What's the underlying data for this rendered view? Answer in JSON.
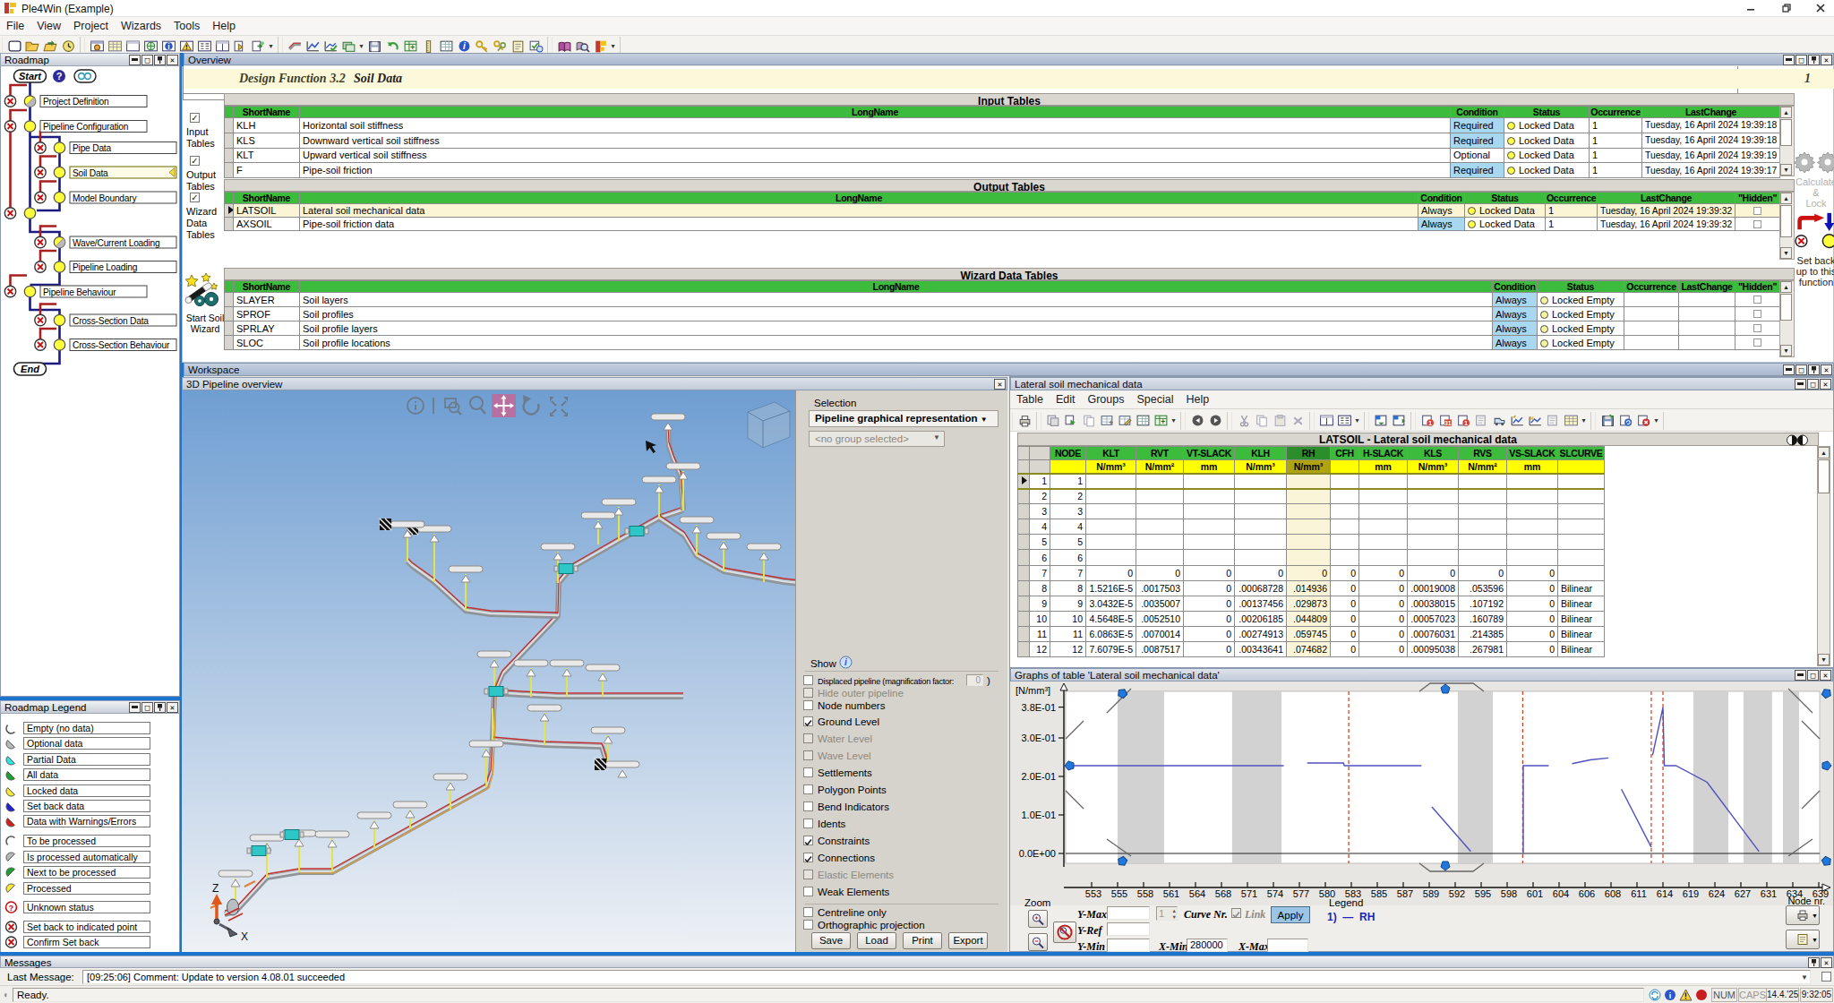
{
  "app": {
    "title": "Ple4Win (Example)"
  },
  "menu": [
    "File",
    "View",
    "Project",
    "Wizards",
    "Tools",
    "Help"
  ],
  "toolbar": {
    "groups": [
      [
        "new-doc-icon",
        "open-folder-icon",
        "import-folder-icon",
        "history-clock-icon"
      ],
      [
        "window-gear-icon",
        "window-table-icon",
        "window-blank-icon",
        "window-globe-icon",
        "window-info-icon",
        "window-warning-icon",
        "window-tree-icon",
        "window-split-icon",
        "copy-doc-icon",
        "export-doc-icon",
        "dropdown-icon"
      ],
      [
        "pipeline-icon",
        "chart-design-icon",
        "chart-check-icon",
        "layers-icon",
        "dropdown-icon",
        "floppy-icon",
        "undo-icon",
        "calc-table-icon",
        "ruler-icon",
        "table-small-icon",
        "info-icon",
        "key-icon",
        "key-pair-icon",
        "notes-icon",
        "link-check-icon"
      ],
      [
        "book-icon",
        "book-search-icon",
        "bookmark-icon",
        "dropdown-icon"
      ]
    ]
  },
  "roadmap": {
    "title": "Roadmap",
    "start_label": "Start",
    "end_label": "End",
    "nodes": [
      {
        "label": "Project Definition",
        "level": 0,
        "state": "locked-auto"
      },
      {
        "label": "Pipeline Configuration",
        "level": 0,
        "state": "locked"
      },
      {
        "label": "Pipe Data",
        "level": 1,
        "state": "locked"
      },
      {
        "label": "Soil Data",
        "level": 1,
        "state": "locked",
        "selected": true
      },
      {
        "label": "Model Boundary",
        "level": 1,
        "state": "locked"
      },
      {
        "label": "",
        "level": 0,
        "state": "locked",
        "junction": true
      },
      {
        "label": "Wave/Current Loading",
        "level": 1,
        "state": "locked-auto"
      },
      {
        "label": "Pipeline Loading",
        "level": 1,
        "state": "locked"
      },
      {
        "label": "Pipeline Behaviour",
        "level": 0,
        "state": "locked"
      },
      {
        "label": "Cross-Section Data",
        "level": 1,
        "state": "locked"
      },
      {
        "label": "Cross-Section Behaviour",
        "level": 1,
        "state": "locked"
      }
    ]
  },
  "legend": {
    "title": "Roadmap Legend",
    "items": [
      {
        "label": "Empty (no data)",
        "icon": "half-open"
      },
      {
        "label": "Optional data",
        "icon": "half-gray"
      },
      {
        "label": "Partial Data",
        "icon": "half-cyan"
      },
      {
        "label": "All data",
        "icon": "half-green"
      },
      {
        "label": "Locked data",
        "icon": "half-yellow"
      },
      {
        "label": "Set back data",
        "icon": "half-blue"
      },
      {
        "label": "Data with Warnings/Errors",
        "icon": "half-red"
      },
      {
        "label": "To be processed",
        "icon": "arc-open"
      },
      {
        "label": "Is processed automatically",
        "icon": "arc-gray"
      },
      {
        "label": "Next to be processed",
        "icon": "arc-green"
      },
      {
        "label": "Processed",
        "icon": "arc-yellow"
      },
      {
        "label": "Unknown status",
        "icon": "circle-question"
      },
      {
        "label": "Set back to indicated point",
        "icon": "circle-x"
      },
      {
        "label": "Confirm Set back",
        "icon": "circle-x"
      }
    ]
  },
  "overview": {
    "title": "Overview",
    "design_function": "Design Function 3.2",
    "design_name": "Soil Data",
    "page_number": "1",
    "gutter": {
      "input": [
        "Input",
        "Tables"
      ],
      "output": [
        "Output",
        "Tables"
      ],
      "wizard": [
        "Wizard",
        "Data",
        "Tables"
      ],
      "start_wizard": [
        "Start Soil",
        "Wizard"
      ]
    },
    "calc_lock": [
      "Calculate",
      "&",
      "Lock"
    ],
    "set_back": [
      "Set back",
      "up to this",
      "function"
    ],
    "input_tables": {
      "title": "Input Tables",
      "columns": [
        "ShortName",
        "LongName",
        "Condition",
        "Status",
        "Occurrence",
        "LastChange"
      ],
      "rows": [
        {
          "short": "KLH",
          "long": "Horizontal soil stiffness",
          "condition": "Required",
          "status": "Locked Data",
          "occ": "1",
          "change": "Tuesday, 16 April 2024 19:39:18"
        },
        {
          "short": "KLS",
          "long": "Downward vertical soil stiffness",
          "condition": "Required",
          "status": "Locked Data",
          "occ": "1",
          "change": "Tuesday, 16 April 2024 19:39:18"
        },
        {
          "short": "KLT",
          "long": "Upward vertical soil stiffness",
          "condition": "Optional",
          "status": "Locked Data",
          "occ": "1",
          "change": "Tuesday, 16 April 2024 19:39:19"
        },
        {
          "short": "F",
          "long": "Pipe-soil friction",
          "condition": "Required",
          "status": "Locked Data",
          "occ": "1",
          "change": "Tuesday, 16 April 2024 19:39:17"
        }
      ]
    },
    "output_tables": {
      "title": "Output Tables",
      "columns": [
        "ShortName",
        "LongName",
        "Condition",
        "Status",
        "Occurrence",
        "LastChange",
        "\"Hidden\""
      ],
      "rows": [
        {
          "short": "LATSOIL",
          "long": "Lateral soil mechanical data",
          "condition": "Always",
          "status": "Locked Data",
          "occ": "1",
          "change": "Tuesday, 16 April 2024 19:39:32",
          "selected": true
        },
        {
          "short": "AXSOIL",
          "long": "Pipe-soil friction data",
          "condition": "Always",
          "status": "Locked Data",
          "occ": "1",
          "change": "Tuesday, 16 April 2024 19:39:32"
        }
      ]
    },
    "wizard_tables": {
      "title": "Wizard Data Tables",
      "columns": [
        "ShortName",
        "LongName",
        "Condition",
        "Status",
        "Occurrence",
        "LastChange",
        "\"Hidden\""
      ],
      "rows": [
        {
          "short": "SLAYER",
          "long": "Soil layers",
          "condition": "Always",
          "status": "Locked Empty"
        },
        {
          "short": "SPROF",
          "long": "Soil profiles",
          "condition": "Always",
          "status": "Locked Empty"
        },
        {
          "short": "SPRLAY",
          "long": "Soil profile layers",
          "condition": "Always",
          "status": "Locked Empty"
        },
        {
          "short": "SLOC",
          "long": "Soil profile locations",
          "condition": "Always",
          "status": "Locked Empty"
        }
      ]
    }
  },
  "workspace": {
    "title": "Workspace"
  },
  "view3d": {
    "title": "3D Pipeline overview",
    "selection_label": "Selection",
    "dropdown1": "Pipeline graphical representation",
    "dropdown2": "<no group selected>",
    "show_label": "Show",
    "magnification_value": "0",
    "show_items": [
      {
        "label": "Displaced pipeline (magnification factor:",
        "suffix": ")",
        "state": "off",
        "field": "0"
      },
      {
        "label": "Hide outer pipeline",
        "state": "disabled"
      },
      {
        "label": "Node numbers",
        "state": "off"
      },
      {
        "label": "Ground Level",
        "state": "on"
      },
      {
        "label": "Water Level",
        "state": "disabled"
      },
      {
        "label": "Wave Level",
        "state": "disabled"
      },
      {
        "label": "Settlements",
        "state": "off"
      },
      {
        "label": "Polygon Points",
        "state": "off"
      },
      {
        "label": "Bend Indicators",
        "state": "off"
      },
      {
        "label": "Idents",
        "state": "off"
      },
      {
        "label": "Constraints",
        "state": "on"
      },
      {
        "label": "Connections",
        "state": "on"
      },
      {
        "label": "Elastic Elements",
        "state": "disabled"
      },
      {
        "label": "Weak Elements",
        "state": "off"
      }
    ],
    "show_items2": [
      {
        "label": "Centreline only",
        "state": "off"
      },
      {
        "label": "Orthographic projection",
        "state": "off"
      }
    ],
    "buttons": [
      "Save",
      "Load",
      "Print",
      "Export"
    ],
    "axes": {
      "z": "Z",
      "x": "X"
    }
  },
  "latsoil": {
    "title": "Lateral soil mechanical data",
    "menu": [
      "Table",
      "Edit",
      "Groups",
      "Special",
      "Help"
    ],
    "table_title": "LATSOIL - Lateral soil mechanical data",
    "columns": [
      "NODE",
      "KLT",
      "RVT",
      "VT-SLACK",
      "KLH",
      "RH",
      "CFH",
      "H-SLACK",
      "KLS",
      "RVS",
      "VS-SLACK",
      "SLCURVE"
    ],
    "units": [
      "",
      "N/mm³",
      "N/mm²",
      "mm",
      "N/mm³",
      "N/mm³",
      "",
      "mm",
      "N/mm³",
      "N/mm²",
      "mm",
      ""
    ],
    "selected_column": "RH",
    "rows": [
      [
        "1",
        "1",
        "",
        "",
        "",
        "",
        "",
        "",
        "",
        "",
        "",
        "",
        ""
      ],
      [
        "2",
        "2",
        "",
        "",
        "",
        "",
        "",
        "",
        "",
        "",
        "",
        "",
        ""
      ],
      [
        "3",
        "3",
        "",
        "",
        "",
        "",
        "",
        "",
        "",
        "",
        "",
        "",
        ""
      ],
      [
        "4",
        "4",
        "",
        "",
        "",
        "",
        "",
        "",
        "",
        "",
        "",
        "",
        ""
      ],
      [
        "5",
        "5",
        "",
        "",
        "",
        "",
        "",
        "",
        "",
        "",
        "",
        "",
        ""
      ],
      [
        "6",
        "6",
        "",
        "",
        "",
        "",
        "",
        "",
        "",
        "",
        "",
        "",
        ""
      ],
      [
        "7",
        "7",
        "0",
        "0",
        "0",
        "0",
        "0",
        "0",
        "0",
        "0",
        "0",
        "0",
        ""
      ],
      [
        "8",
        "8",
        "1.5216E-5",
        ".0017503",
        "0",
        ".00068728",
        ".014936",
        "0",
        "0",
        ".00019008",
        ".053596",
        "0",
        "Bilinear"
      ],
      [
        "9",
        "9",
        "3.0432E-5",
        ".0035007",
        "0",
        ".00137456",
        ".029873",
        "0",
        "0",
        ".00038015",
        ".107192",
        "0",
        "Bilinear"
      ],
      [
        "10",
        "10",
        "4.5648E-5",
        ".0052510",
        "0",
        ".00206185",
        ".044809",
        "0",
        "0",
        ".00057023",
        ".160789",
        "0",
        "Bilinear"
      ],
      [
        "11",
        "11",
        "6.0863E-5",
        ".0070014",
        "0",
        ".00274913",
        ".059745",
        "0",
        "0",
        ".00076031",
        ".214385",
        "0",
        "Bilinear"
      ],
      [
        "12",
        "12",
        "7.6079E-5",
        ".0087517",
        "0",
        ".00343641",
        ".074682",
        "0",
        "0",
        ".00095038",
        ".267981",
        "0",
        "Bilinear"
      ]
    ]
  },
  "graph": {
    "title": "Graphs of table 'Lateral soil mechanical data'",
    "controls": {
      "zoom": "Zoom",
      "y_max": "Y-Max",
      "y_ref": "Y-Ref",
      "y_min": "Y-Min",
      "curve_spin": "1",
      "curve_nr": "Curve Nr.",
      "link": "Link",
      "apply": "Apply",
      "x_min": "X-Min",
      "x_min_value": "280000",
      "x_max": "X-Max",
      "legend_title": "Legend",
      "legend_no": "1)",
      "legend_name": "RH"
    }
  },
  "chart_data": {
    "type": "line",
    "title": "Graphs of table 'Lateral soil mechanical data'",
    "ylabel": "[N/mm³]",
    "xlabel": "Node nr.",
    "y_ticks": [
      {
        "v": 0.38,
        "label": "3.8E-01"
      },
      {
        "v": 0.3,
        "label": "3.0E-01"
      },
      {
        "v": 0.2,
        "label": "2.0E-01"
      },
      {
        "v": 0.1,
        "label": "1.0E-01"
      },
      {
        "v": 0.0,
        "label": "0.0E+00"
      }
    ],
    "x_tick_labels": [
      "553",
      "555",
      "558",
      "561",
      "564",
      "568",
      "571",
      "574",
      "577",
      "580",
      "583",
      "585",
      "587",
      "589",
      "592",
      "595",
      "598",
      "601",
      "604",
      "606",
      "608",
      "611",
      "614",
      "619",
      "624",
      "627",
      "631",
      "634",
      "639"
    ],
    "ylim": [
      0,
      0.4
    ],
    "grid": false,
    "legend_position": "bottom",
    "series_name": "RH",
    "note": "x values below are fractional tick indexes into x_tick_labels; y in N/mm3",
    "segments": [
      [
        [
          -0.95,
          0.228
        ],
        [
          7.4,
          0.228
        ]
      ],
      [
        [
          8.3,
          0.235
        ],
        [
          9.7,
          0.235
        ],
        [
          9.73,
          0.228
        ],
        [
          12.7,
          0.228
        ]
      ],
      [
        [
          13.1,
          0.121
        ],
        [
          14.6,
          0.005
        ]
      ],
      [
        [
          16.62,
          0.0
        ],
        [
          16.62,
          0.228
        ],
        [
          17.6,
          0.228
        ]
      ],
      [
        [
          18.5,
          0.233
        ],
        [
          19.2,
          0.243
        ],
        [
          19.9,
          0.248
        ]
      ],
      [
        [
          20.4,
          0.167
        ],
        [
          21.55,
          0.016
        ]
      ],
      [
        [
          21.6,
          0.255
        ],
        [
          22.0,
          0.379
        ],
        [
          22.05,
          0.228
        ],
        [
          22.5,
          0.228
        ],
        [
          23.7,
          0.185
        ],
        [
          25.7,
          0.005
        ]
      ]
    ],
    "gray_bands": [
      [
        1.0,
        2.79
      ],
      [
        5.41,
        7.31
      ],
      [
        14.1,
        15.45
      ],
      [
        23.17,
        24.52
      ],
      [
        25.1,
        26.2
      ],
      [
        26.62,
        27.24
      ]
    ],
    "red_dashed_x": [
      9.9,
      16.6,
      21.55,
      22.0
    ]
  },
  "messages": {
    "title": "Messages",
    "last_label": "Last Message:",
    "last_value": "[09:25:06] Comment: Update to version 4.08.01 succeeded"
  },
  "statusbar": {
    "ready": "Ready.",
    "num": "NUM",
    "caps": "CAPS",
    "date": "14.4.'25",
    "time": "9:32:05"
  }
}
